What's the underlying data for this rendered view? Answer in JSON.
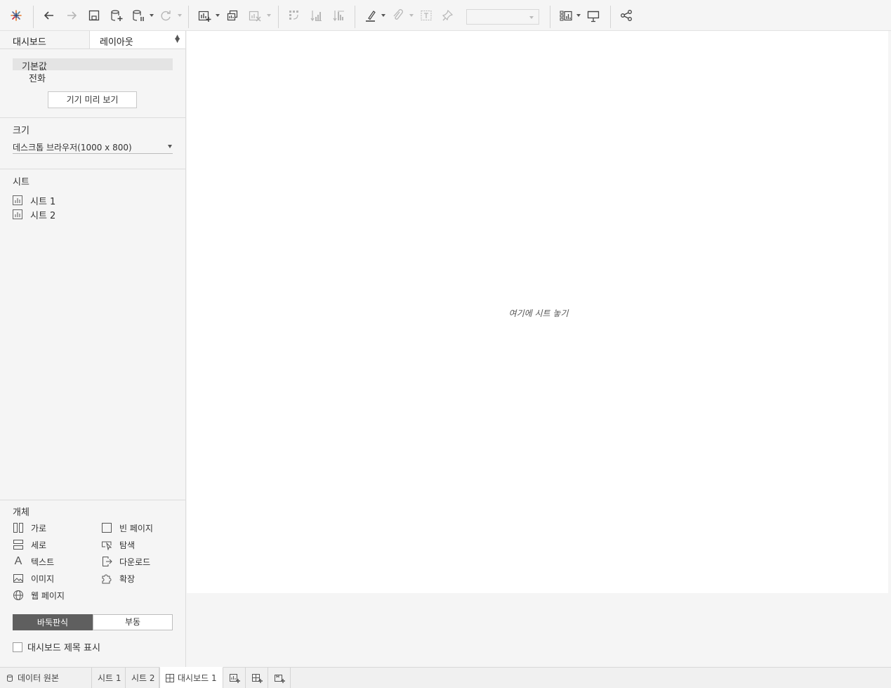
{
  "left_panel": {
    "tabs": {
      "dashboard": "대시보드",
      "layout": "레이아웃"
    },
    "devices": {
      "default": "기본값",
      "phone": "전화",
      "preview_button": "기기 미리 보기"
    },
    "size": {
      "title": "크기",
      "value": "데스크톱 브라우저(1000 x 800)"
    },
    "sheets": {
      "title": "시트",
      "items": [
        "시트 1",
        "시트 2"
      ]
    },
    "objects": {
      "title": "개체",
      "horizontal": "가로",
      "vertical": "세로",
      "text": "텍스트",
      "image": "이미지",
      "web_page": "웹 페이지",
      "blank": "빈 페이지",
      "navigation": "탐색",
      "download": "다운로드",
      "extension": "확장"
    },
    "mode": {
      "tiled": "바둑판식",
      "floating": "부동"
    },
    "show_title": "대시보드 제목 표시"
  },
  "canvas": {
    "drop_hint": "여기에 시트 놓기"
  },
  "bottom_tabs": {
    "data_source": "데이터 원본",
    "sheet1": "시트 1",
    "sheet2": "시트 2",
    "dashboard1": "대시보드 1"
  }
}
